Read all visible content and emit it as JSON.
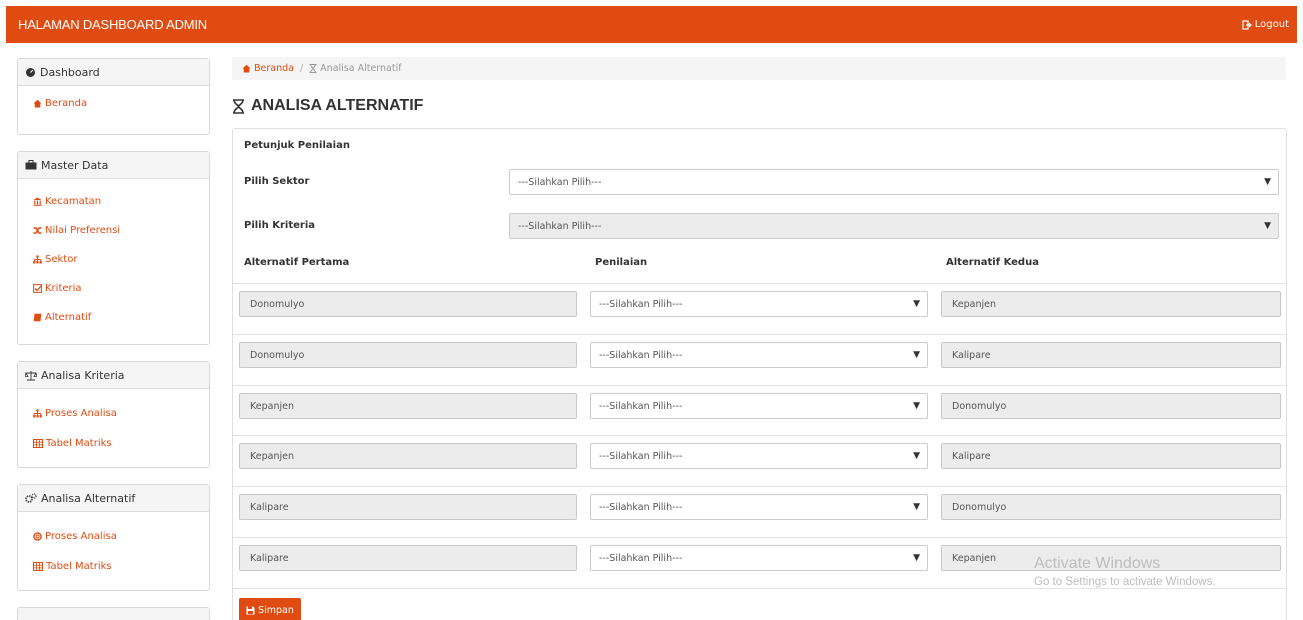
{
  "header": {
    "brand": "HALAMAN DASHBOARD ADMIN",
    "logout_label": "Logout"
  },
  "sidebar": {
    "panels": [
      {
        "title": "Dashboard",
        "icon": "dashboard-icon",
        "items": [
          {
            "label": "Beranda",
            "icon": "home-icon"
          }
        ]
      },
      {
        "title": "Master Data",
        "icon": "briefcase-icon",
        "items": [
          {
            "label": "Kecamatan",
            "icon": "bank-icon"
          },
          {
            "label": "Nilai Preferensi",
            "icon": "random-icon"
          },
          {
            "label": "Sektor",
            "icon": "sitemap-icon"
          },
          {
            "label": "Kriteria",
            "icon": "check-square-icon"
          },
          {
            "label": "Alternatif",
            "icon": "book-icon"
          }
        ]
      },
      {
        "title": "Analisa Kriteria",
        "icon": "balance-scale-icon",
        "items": [
          {
            "label": "Proses Analisa",
            "icon": "sitemap-icon"
          },
          {
            "label": "Tabel Matriks",
            "icon": "table-icon"
          }
        ]
      },
      {
        "title": "Analisa Alternatif",
        "icon": "cogs-icon",
        "items": [
          {
            "label": "Proses Analisa",
            "icon": "life-ring-icon"
          },
          {
            "label": "Tabel Matriks",
            "icon": "table-icon"
          }
        ]
      }
    ]
  },
  "breadcrumb": {
    "home": "Beranda",
    "separator": "/",
    "current": "Analisa Alternatif"
  },
  "page": {
    "title": "ANALISA ALTERNATIF"
  },
  "form": {
    "guide_label": "Petunjuk Penilaian",
    "sector_label": "Pilih Sektor",
    "sector_value": "---Silahkan Pilih---",
    "criteria_label": "Pilih Kriteria",
    "criteria_value": "---Silahkan Pilih---",
    "col_first": "Alternatif Pertama",
    "col_rating": "Penilaian",
    "col_second": "Alternatif Kedua",
    "rows": [
      {
        "first": "Donomulyo",
        "rating": "---Silahkan Pilih---",
        "second": "Kepanjen"
      },
      {
        "first": "Donomulyo",
        "rating": "---Silahkan Pilih---",
        "second": "Kalipare"
      },
      {
        "first": "Kepanjen",
        "rating": "---Silahkan Pilih---",
        "second": "Donomulyo"
      },
      {
        "first": "Kepanjen",
        "rating": "---Silahkan Pilih---",
        "second": "Kalipare"
      },
      {
        "first": "Kalipare",
        "rating": "---Silahkan Pilih---",
        "second": "Donomulyo"
      },
      {
        "first": "Kalipare",
        "rating": "---Silahkan Pilih---",
        "second": "Kepanjen"
      }
    ],
    "save_label": "Simpan",
    "caret_glyph": "▼"
  },
  "watermark": {
    "line1": "Activate Windows",
    "line2": "Go to Settings to activate Windows."
  },
  "colors": {
    "accent": "#e04b12",
    "panel_head_bg": "#f5f5f5",
    "field_bg": "#ececec"
  }
}
